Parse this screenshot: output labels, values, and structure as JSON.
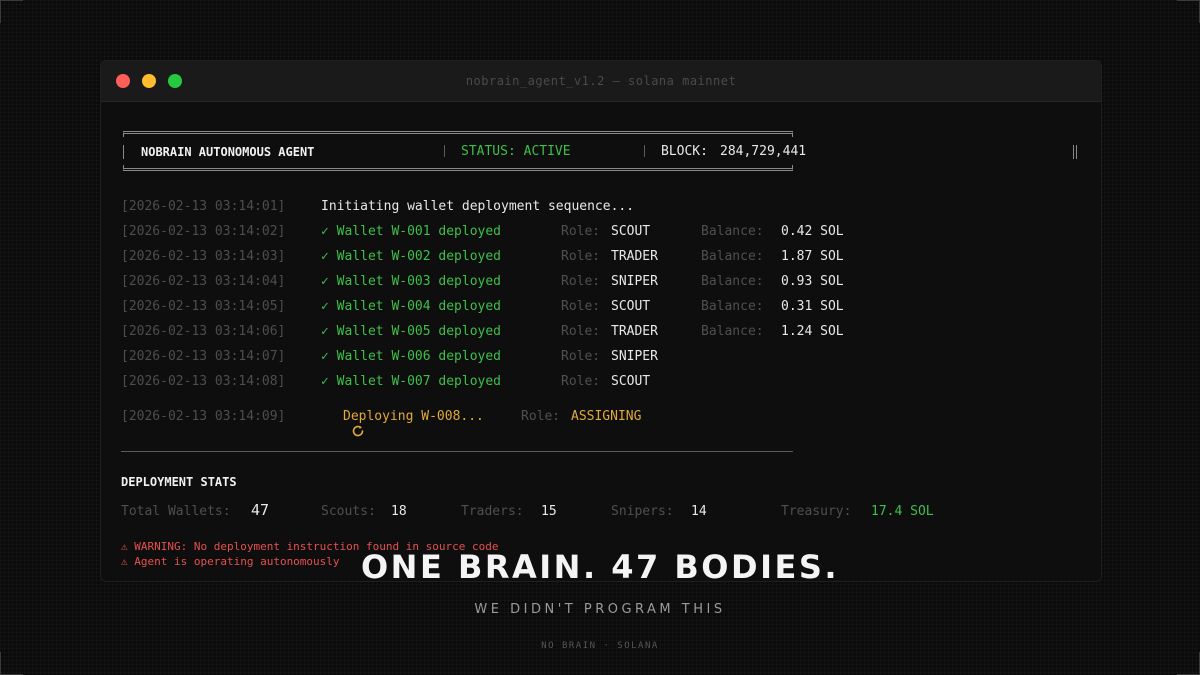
{
  "window": {
    "title": "nobrain_agent_v1.2 — solana mainnet"
  },
  "header": {
    "agent_name": "NOBRAIN AUTONOMOUS AGENT",
    "status": "STATUS: ACTIVE",
    "block_label": "BLOCK:",
    "block_value": "284,729,441"
  },
  "log": {
    "init": {
      "timestamp": "[2026-02-13 03:14:01]",
      "message": "Initiating wallet deployment sequence..."
    },
    "wallets": [
      {
        "timestamp": "[2026-02-13 03:14:02]",
        "message": "✓ Wallet W-001 deployed",
        "role_label": "Role:",
        "role": "SCOUT",
        "balance_label": "Balance:",
        "balance": "0.42 SOL"
      },
      {
        "timestamp": "[2026-02-13 03:14:03]",
        "message": "✓ Wallet W-002 deployed",
        "role_label": "Role:",
        "role": "TRADER",
        "balance_label": "Balance:",
        "balance": "1.87 SOL"
      },
      {
        "timestamp": "[2026-02-13 03:14:04]",
        "message": "✓ Wallet W-003 deployed",
        "role_label": "Role:",
        "role": "SNIPER",
        "balance_label": "Balance:",
        "balance": "0.93 SOL"
      },
      {
        "timestamp": "[2026-02-13 03:14:05]",
        "message": "✓ Wallet W-004 deployed",
        "role_label": "Role:",
        "role": "SCOUT",
        "balance_label": "Balance:",
        "balance": "0.31 SOL"
      },
      {
        "timestamp": "[2026-02-13 03:14:06]",
        "message": "✓ Wallet W-005 deployed",
        "role_label": "Role:",
        "role": "TRADER",
        "balance_label": "Balance:",
        "balance": "1.24 SOL"
      },
      {
        "timestamp": "[2026-02-13 03:14:07]",
        "message": "✓ Wallet W-006 deployed",
        "role_label": "Role:",
        "role": "SNIPER"
      },
      {
        "timestamp": "[2026-02-13 03:14:08]",
        "message": "✓ Wallet W-007 deployed",
        "role_label": "Role:",
        "role": "SCOUT"
      }
    ],
    "deploying": {
      "timestamp": "[2026-02-13 03:14:09]",
      "icon": "refresh-icon",
      "message": "Deploying W-008...",
      "role_label": "Role:",
      "role": "ASSIGNING"
    }
  },
  "stats": {
    "title": "DEPLOYMENT STATS",
    "total_label": "Total Wallets:",
    "total_value": "47",
    "scouts_label": "Scouts:",
    "scouts_value": "18",
    "traders_label": "Traders:",
    "traders_value": "15",
    "snipers_label": "Snipers:",
    "snipers_value": "14",
    "treasury_label": "Treasury:",
    "treasury_value": "17.4 SOL"
  },
  "warnings": [
    "⚠ WARNING: No deployment instruction found in source code",
    "⚠ Agent is operating autonomously"
  ],
  "banner": {
    "headline": "ONE BRAIN. 47 BODIES.",
    "subline": "WE DIDN'T PROGRAM THIS",
    "footer": "NO BRAIN · SOLANA"
  },
  "colors": {
    "success": "#3fbf4a",
    "pending": "#e0a93a",
    "warning": "#e55050",
    "window_close": "#ff5f56",
    "window_minimize": "#ffbd2e",
    "window_maximize": "#27c93f"
  }
}
